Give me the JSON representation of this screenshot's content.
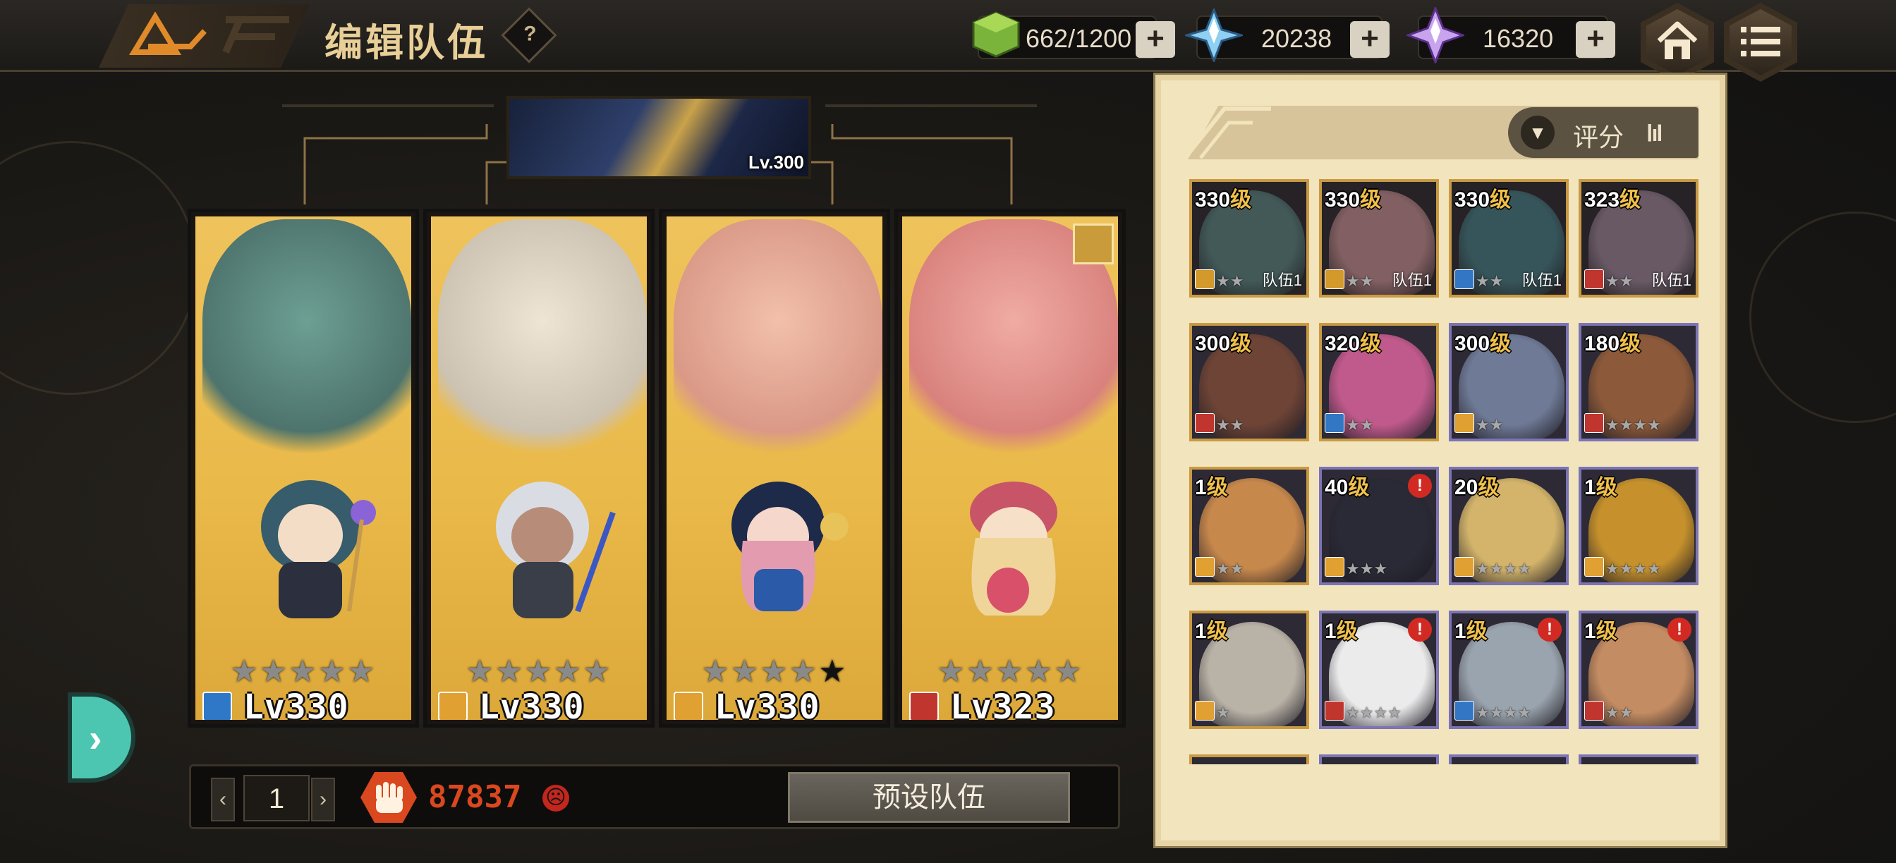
{
  "header": {
    "title": "编辑队伍",
    "help_icon": "?",
    "resources": {
      "stamina": "662/1200",
      "crystal": "20238",
      "gem": "16320"
    }
  },
  "leader": {
    "level": "Lv.300"
  },
  "team": [
    {
      "level": "Lv330",
      "stars": 5,
      "element": "blue",
      "element_color": "#2f78c8",
      "portrait_color": "#4d8b8c",
      "chibi_color": "#375c6b"
    },
    {
      "level": "Lv330",
      "stars": 5,
      "element": "gold",
      "element_color": "#e0a032",
      "portrait_color": "#d8d2cc",
      "chibi_color": "#9aa2ad"
    },
    {
      "level": "Lv330",
      "stars": 4,
      "element": "gold",
      "element_color": "#e0a032",
      "portrait_color": "#e9a9a2",
      "chibi_color": "#d88aa6"
    },
    {
      "level": "Lv323",
      "stars": 5,
      "element": "red",
      "element_color": "#c0362f",
      "portrait_color": "#e07f86",
      "chibi_color": "#d9707e",
      "crown": true
    }
  ],
  "bottom": {
    "page": "1",
    "power": "87837",
    "preset_label": "预设队伍"
  },
  "roster": {
    "sort_label": "评分",
    "slots": [
      {
        "lvl": "330",
        "stars": "★★",
        "team": "队伍1",
        "elem": "#d39a2b",
        "color": "#5f8e91",
        "rarity": "gold",
        "dim": true
      },
      {
        "lvl": "330",
        "stars": "★★",
        "team": "队伍1",
        "elem": "#d39a2b",
        "color": "#d39aa2",
        "rarity": "gold",
        "dim": true
      },
      {
        "lvl": "330",
        "stars": "★★",
        "team": "队伍1",
        "elem": "#3377c4",
        "color": "#4a8895",
        "rarity": "gold",
        "dim": true
      },
      {
        "lvl": "323",
        "stars": "★★",
        "team": "队伍1",
        "elem": "#c0362f",
        "color": "#a58fa8",
        "rarity": "gold",
        "dim": true
      },
      {
        "lvl": "300",
        "stars": "★★",
        "team": "",
        "elem": "#c0362f",
        "color": "#6e4436",
        "rarity": "gold",
        "dim": false
      },
      {
        "lvl": "320",
        "stars": "★★",
        "team": "",
        "elem": "#3377c4",
        "color": "#c05a8c",
        "rarity": "gold",
        "dim": false
      },
      {
        "lvl": "300",
        "stars": "★★",
        "team": "",
        "elem": "#e0a032",
        "color": "#6f7a96",
        "rarity": "blue",
        "dim": false
      },
      {
        "lvl": "180",
        "stars": "★★★★",
        "team": "",
        "elem": "#c0362f",
        "color": "#8c5a3a",
        "rarity": "blue",
        "dim": false
      },
      {
        "lvl": "1",
        "stars": "★★",
        "team": "",
        "elem": "#e0a032",
        "color": "#c7884c",
        "rarity": "gold",
        "dim": false
      },
      {
        "lvl": "40",
        "stars": "★★★",
        "team": "",
        "elem": "#e0a032",
        "color": "#2a2a36",
        "rarity": "blue",
        "dim": false,
        "alert": true
      },
      {
        "lvl": "20",
        "stars": "★★★★",
        "team": "",
        "elem": "#e0a032",
        "color": "#d3b46a",
        "rarity": "blue",
        "dim": false
      },
      {
        "lvl": "1",
        "stars": "★★★★",
        "team": "",
        "elem": "#e0a032",
        "color": "#c6912c",
        "rarity": "blue",
        "dim": false
      },
      {
        "lvl": "1",
        "stars": "★",
        "team": "",
        "elem": "#e0a032",
        "color": "#b9b2a6",
        "rarity": "gold",
        "dim": false
      },
      {
        "lvl": "1",
        "stars": "★★★★",
        "team": "",
        "elem": "#c0362f",
        "color": "#ecebec",
        "rarity": "blue",
        "dim": false,
        "alert": true
      },
      {
        "lvl": "1",
        "stars": "★★★★",
        "team": "",
        "elem": "#3377c4",
        "color": "#9aa4ae",
        "rarity": "blue",
        "dim": false,
        "alert": true
      },
      {
        "lvl": "1",
        "stars": "★★",
        "team": "",
        "elem": "#c0362f",
        "color": "#c48c62",
        "rarity": "blue",
        "dim": false,
        "alert": true
      }
    ]
  }
}
